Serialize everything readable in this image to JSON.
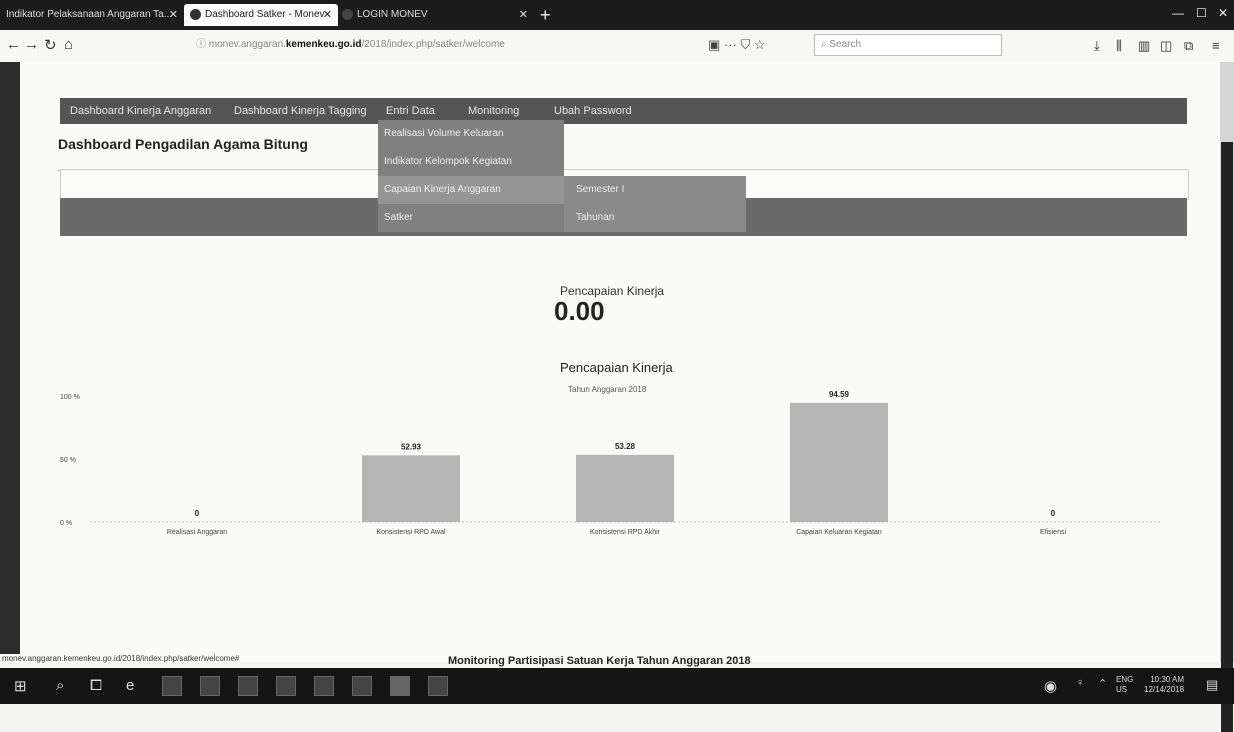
{
  "browser": {
    "tabs": [
      {
        "label": "Indikator Pelaksanaan Anggaran Ta...",
        "active": false
      },
      {
        "label": "Dashboard Satker - Monev",
        "active": true
      },
      {
        "label": "LOGIN MONEV",
        "active": false
      }
    ],
    "url_prefix": "monev.anggaran.",
    "url_host": "kemenkeu.go.id",
    "url_path": "/2018/index.php/satker/welcome",
    "search_placeholder": "Search",
    "page_actions": "··· ⛉ ☆"
  },
  "menu": {
    "items": [
      "Dashboard Kinerja Anggaran",
      "Dashboard Kinerja Tagging",
      "Entri Data",
      "Monitoring",
      "Ubah Password"
    ],
    "dropdown": [
      "Realisasi Volume Keluaran",
      "Indikator Kelompok Kegiatan",
      "Capaian Kinerja Anggaran",
      "Satker"
    ],
    "submenu": [
      "Semester I",
      "Tahunan"
    ]
  },
  "page": {
    "title": "Dashboard Pengadilan Agama Bitung",
    "perf_label": "Pencapaian Kinerja",
    "perf_value": "0.00",
    "chart_title": "Pencapaian Kinerja",
    "chart_subtitle": "Tahun Anggaran  2018",
    "footer_title": "Monitoring Partisipasi Satuan Kerja Tahun Anggaran 2018"
  },
  "status_url": "monev.anggaran.kemenkeu.go.id/2018/index.php/satker/welcome#",
  "taskbar": {
    "lang": "ENG",
    "time": "10:30 AM",
    "lang2": "US",
    "date": "12/14/2018"
  },
  "chart_data": {
    "type": "bar",
    "categories": [
      "Realisasi Anggaran",
      "Konsistensi RPD Awal",
      "Konsistensi RPD Akhir",
      "Capaian Keluaran Kegiatan",
      "Efisiensi"
    ],
    "values": [
      0,
      52.93,
      53.28,
      94.59,
      0
    ],
    "value_labels": [
      "0",
      "52.93",
      "53.28",
      "94.59",
      "0"
    ],
    "y_ticks": [
      "100 %",
      "50 %",
      "0 %"
    ],
    "ylim": [
      0,
      100
    ],
    "bar_color": "#b5b5b5",
    "grid": false
  }
}
